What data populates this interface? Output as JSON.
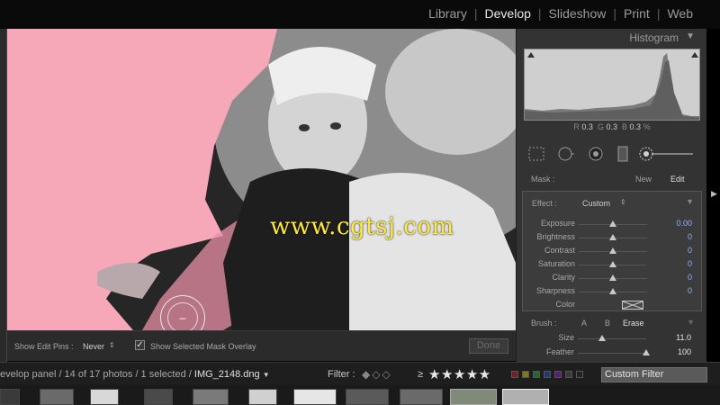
{
  "modules": {
    "items": [
      "Library",
      "Develop",
      "Slideshow",
      "Print",
      "Web"
    ],
    "active": "Develop"
  },
  "watermark": "www.cgtsj.com",
  "histogram": {
    "title": "Histogram",
    "readout": {
      "r_label": "R",
      "r_value": "0.3",
      "g_label": "G",
      "g_value": "0.3",
      "b_label": "B",
      "b_value": "0.3",
      "unit": "%"
    }
  },
  "mask": {
    "label": "Mask :",
    "new": "New",
    "edit": "Edit"
  },
  "effect": {
    "label": "Effect :",
    "value": "Custom",
    "sliders": [
      {
        "label": "Exposure",
        "value": "0.00",
        "position": 0.5
      },
      {
        "label": "Brightness",
        "value": "0",
        "position": 0.5
      },
      {
        "label": "Contrast",
        "value": "0",
        "position": 0.5
      },
      {
        "label": "Saturation",
        "value": "0",
        "position": 0.5
      },
      {
        "label": "Clarity",
        "value": "0",
        "position": 0.5
      },
      {
        "label": "Sharpness",
        "value": "0",
        "position": 0.5
      }
    ],
    "color_label": "Color"
  },
  "brush": {
    "label": "Brush :",
    "a": "A",
    "b": "B",
    "erase": "Erase",
    "sliders": [
      {
        "label": "Size",
        "value": "11.0",
        "position": 0.36
      },
      {
        "label": "Feather",
        "value": "100",
        "position": 1.0
      }
    ]
  },
  "toolbar": {
    "pins_label": "Show Edit Pins :",
    "pins_value": "Never",
    "mask_overlay_label": "Show Selected Mask Overlay",
    "mask_overlay_checked": true,
    "done": "Done"
  },
  "filmstrip": {
    "path": "evelop panel / 14 of 17 photos / 1 selected /",
    "file": "IMG_2148.dng",
    "filter_label": "Filter :",
    "gte": "≥",
    "stars": "★★★★★",
    "custom_filter": "Custom Filter"
  },
  "colors": {
    "mask_overlay": "#f6a8b8",
    "accent_value": "#8ab4ff"
  }
}
